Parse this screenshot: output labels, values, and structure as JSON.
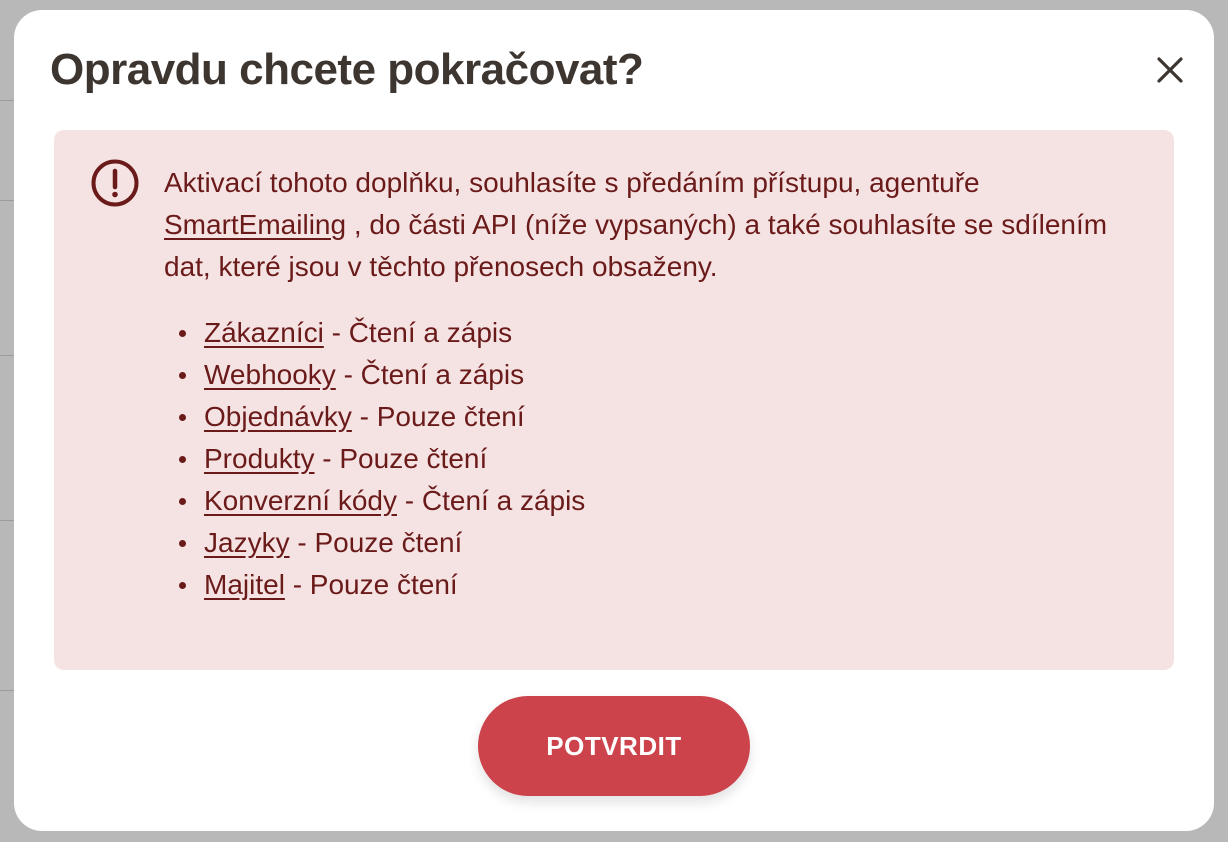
{
  "modal": {
    "title": "Opravdu chcete pokračovat?",
    "close_icon": "close-icon"
  },
  "alert": {
    "icon": "exclamation-circle-icon",
    "text_before_link": "Aktivací tohoto doplňku, souhlasíte s předáním přístupu, agentuře ",
    "agency_link": "SmartEmailing",
    "text_after_link": " , do části API (níže vypsaných) a také souhlasíte se sdílením dat, které jsou v těchto přenosech obsaženy.",
    "permissions": [
      {
        "name": "Zákazníci",
        "access": " - Čtení a zápis"
      },
      {
        "name": "Webhooky",
        "access": " - Čtení a zápis"
      },
      {
        "name": "Objednávky",
        "access": " - Pouze čtení"
      },
      {
        "name": "Produkty",
        "access": " - Pouze čtení"
      },
      {
        "name": "Konverzní kódy",
        "access": " - Čtení a zápis"
      },
      {
        "name": "Jazyky",
        "access": " - Pouze čtení"
      },
      {
        "name": "Majitel",
        "access": " - Pouze čtení"
      }
    ]
  },
  "actions": {
    "confirm_label": "POTVRDIT"
  },
  "colors": {
    "alert_background": "#f5e3e3",
    "alert_text": "#6b1a1a",
    "confirm_button": "#cc434b",
    "title_text": "#3d3530"
  }
}
